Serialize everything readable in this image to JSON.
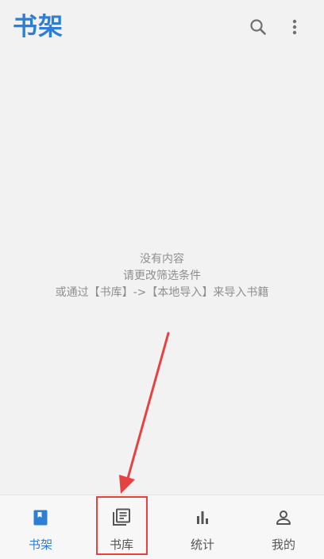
{
  "header": {
    "title": "书架",
    "search_icon": "search-icon",
    "more_icon": "more-vert-icon"
  },
  "empty_state": {
    "line1": "没有内容",
    "line2": "请更改筛选条件",
    "line3": "或通过【书库】->【本地导入】来导入书籍"
  },
  "bottom_nav": {
    "items": [
      {
        "label": "书架",
        "icon": "bookshelf-icon",
        "active": true
      },
      {
        "label": "书库",
        "icon": "library-icon",
        "active": false
      },
      {
        "label": "统计",
        "icon": "bar-chart-icon",
        "active": false
      },
      {
        "label": "我的",
        "icon": "person-icon",
        "active": false
      }
    ]
  },
  "colors": {
    "accent": "#2d7fd3",
    "background": "#f2f2f2",
    "annotation": "#e64242",
    "muted_text": "#8f8f8f"
  }
}
